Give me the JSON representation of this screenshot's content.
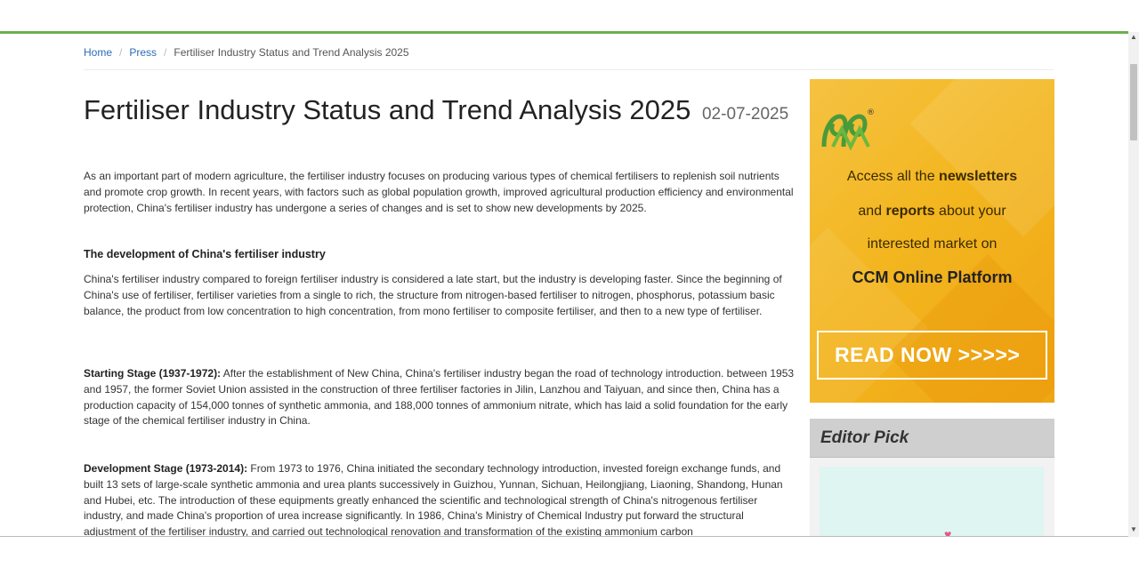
{
  "breadcrumb": {
    "home": "Home",
    "press": "Press",
    "current": "Fertiliser Industry Status and Trend Analysis 2025",
    "separator": "/"
  },
  "article": {
    "title": "Fertiliser Industry Status and Trend Analysis 2025",
    "date": "02-07-2025",
    "intro": "As an important part of modern agriculture, the fertiliser industry focuses on producing various types of chemical fertilisers to replenish soil nutrients and promote crop growth. In recent years, with factors such as global population growth, improved agricultural production efficiency and environmental protection, China's fertiliser industry has undergone a series of changes and is set to show new developments by 2025.",
    "dev_heading": "The development of China's fertiliser industry",
    "dev_paragraph": "China's fertiliser industry compared to foreign fertiliser industry is considered a late start, but the industry is developing faster. Since the beginning of China's use of fertiliser, fertiliser varieties from a single to rich, the structure from nitrogen-based fertiliser to nitrogen, phosphorus, potassium basic balance, the product from low concentration to high concentration, from mono fertiliser to composite fertiliser, and then to a new type of fertiliser.",
    "starting_label": "Starting Stage (1937-1972):",
    "starting_text": " After the establishment of New China, China's fertiliser industry began the road of technology introduction. between 1953 and 1957, the former Soviet Union assisted in the construction of three fertiliser factories in Jilin, Lanzhou and Taiyuan, and since then, China has a production capacity of 154,000 tonnes of synthetic ammonia, and 188,000 tonnes of ammonium nitrate, which has laid a solid foundation for the early stage of the chemical fertiliser industry in China.",
    "development_label": "Development Stage (1973-2014):",
    "development_text": " From 1973 to 1976, China initiated the secondary technology introduction, invested foreign exchange funds, and built 13 sets of large-scale synthetic ammonia and urea plants successively in Guizhou, Yunnan, Sichuan, Heilongjiang, Liaoning, Shandong, Hunan and Hubei, etc. The introduction of these equipments greatly enhanced the scientific and technological strength of China's nitrogenous fertiliser industry, and made China's proportion of urea increase significantly. In 1986, China's Ministry of Chemical Industry put forward the structural adjustment of the fertiliser industry, and carried out technological renovation and transformation of the existing ammonium carbon"
  },
  "ad": {
    "line1_pre": "Access all the ",
    "line1_bold": "newsletters",
    "line2_pre": "and ",
    "line2_bold": "reports",
    "line2_post": " about your",
    "line3": "interested market on",
    "line4": "CCM Online Platform",
    "button": "READ NOW >>>>>",
    "logo_mark": "®"
  },
  "editor_pick": {
    "title": "Editor Pick"
  },
  "colors": {
    "accent_line": "#6ab04c",
    "link": "#2a6db5",
    "ad_yellow": "#f3b61f"
  },
  "icons": {
    "scroll_up": "▲",
    "scroll_down": "▼",
    "heart": "♥"
  }
}
